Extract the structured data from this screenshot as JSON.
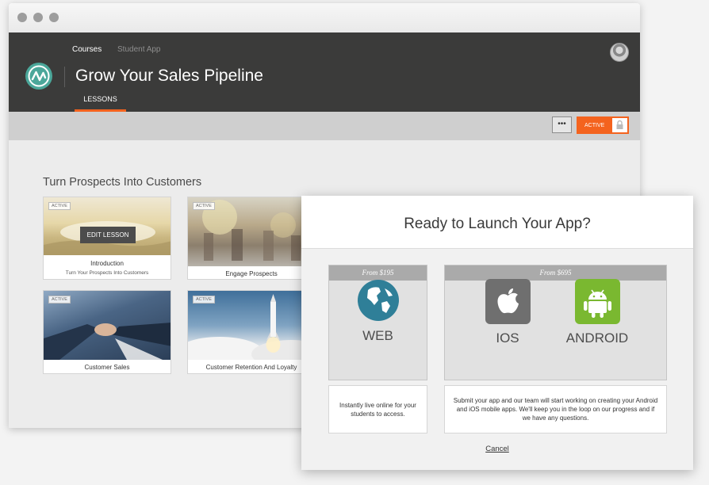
{
  "window": {
    "controls": [
      "close",
      "minimize",
      "maximize"
    ]
  },
  "nav": {
    "courses": "Courses",
    "student_app": "Student App"
  },
  "course": {
    "title": "Grow Your Sales Pipeline",
    "tab": "LESSONS"
  },
  "toolbar": {
    "more_label": "•••",
    "status_label": "ACTIVE"
  },
  "lessons": {
    "section_title": "Turn Prospects Into Customers",
    "edit_label": "EDIT LESSON",
    "cards": [
      {
        "badge": "ACTIVE",
        "title": "Introduction",
        "subtitle": "Turn Your Prospects Into Customers"
      },
      {
        "badge": "ACTIVE",
        "title": "Engage Prospects"
      },
      {
        "badge": "ACTIVE",
        "title": "Customer Sales"
      },
      {
        "badge": "ACTIVE",
        "title": "Customer Retention And Loyalty"
      }
    ]
  },
  "modal": {
    "title": "Ready to Launch Your App?",
    "web": {
      "price": "From $195",
      "label": "WEB",
      "description": "Instantly live online for your students to access."
    },
    "mobile": {
      "price": "From $695",
      "ios_label": "IOS",
      "android_label": "ANDROID",
      "description": "Submit your app and our team will start working on creating your Android and iOS mobile apps.  We'll keep you in the loop on our progress and if we have any questions."
    },
    "cancel_label": "Cancel"
  },
  "colors": {
    "accent": "#f4631e",
    "appbar": "#3b3b3a",
    "logo": "#4ba79a",
    "web_globe": "#2f7f98",
    "ios": "#6f6f6f",
    "android": "#7ab830"
  }
}
